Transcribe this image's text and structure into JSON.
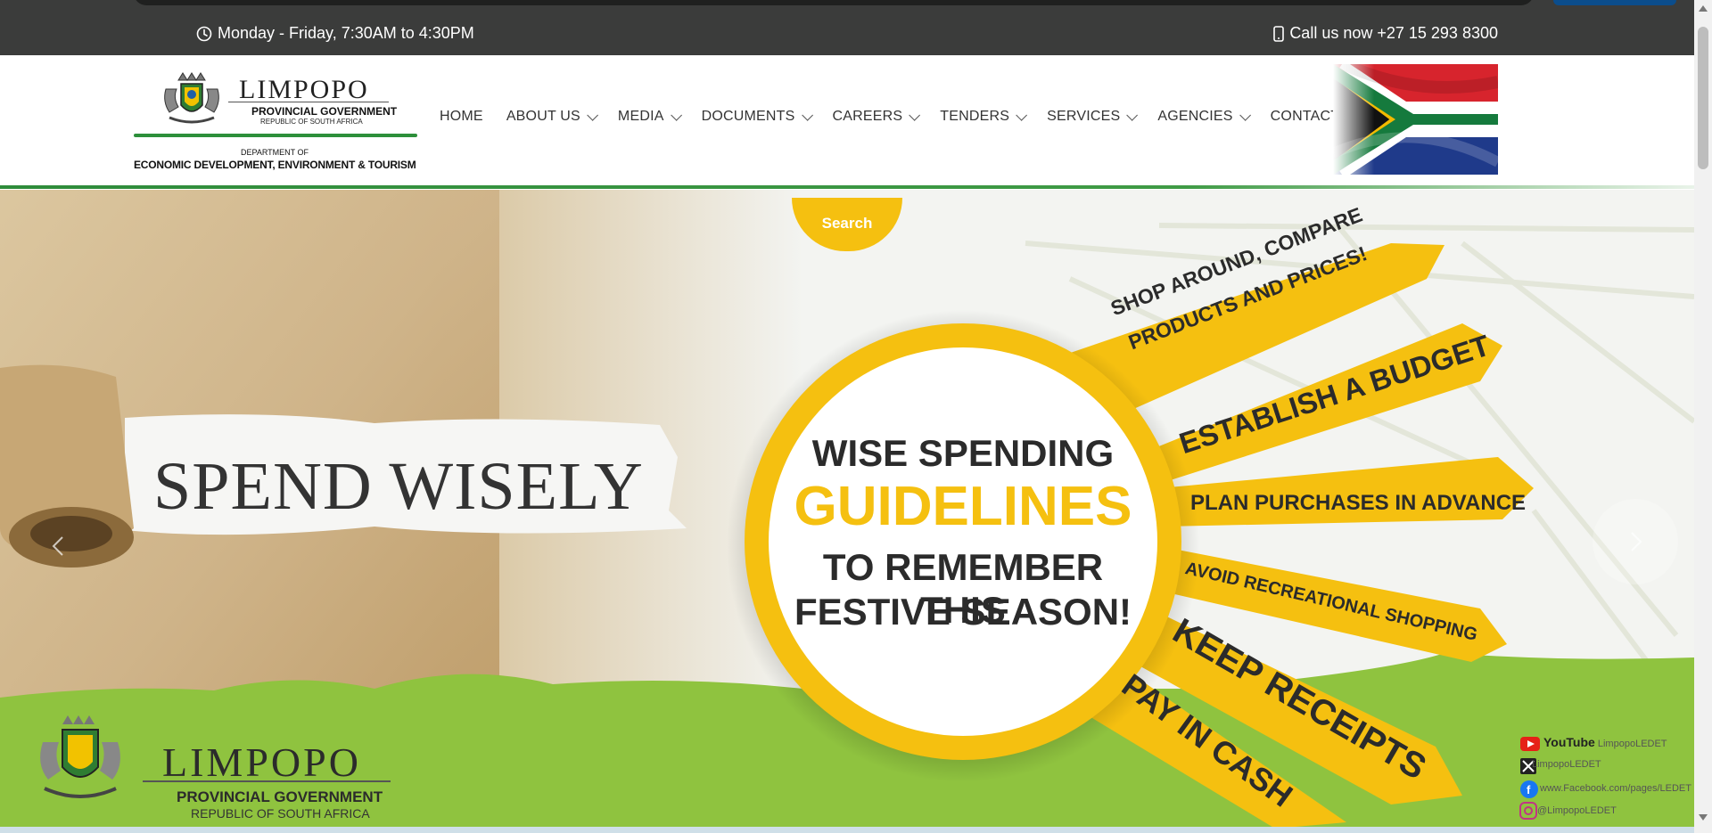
{
  "topbar": {
    "hours": "Monday - Friday, 7:30AM to 4:30PM",
    "phone": "Call us now +27 15 293 8300"
  },
  "logo": {
    "title": "LIMPOPO",
    "subtitle": "PROVINCIAL GOVERNMENT",
    "country": "REPUBLIC OF SOUTH AFRICA",
    "dept_label": "DEPARTMENT OF",
    "dept_name": "ECONOMIC DEVELOPMENT, ENVIRONMENT & TOURISM"
  },
  "nav": {
    "items": [
      {
        "label": "HOME",
        "has_dropdown": false
      },
      {
        "label": "ABOUT US",
        "has_dropdown": true
      },
      {
        "label": "MEDIA",
        "has_dropdown": true
      },
      {
        "label": "DOCUMENTS",
        "has_dropdown": true
      },
      {
        "label": "CAREERS",
        "has_dropdown": true
      },
      {
        "label": "TENDERS",
        "has_dropdown": true
      },
      {
        "label": "SERVICES",
        "has_dropdown": true
      },
      {
        "label": "AGENCIES",
        "has_dropdown": true
      },
      {
        "label": "CONTACTS",
        "has_dropdown": false
      }
    ]
  },
  "search": {
    "label": "Search"
  },
  "slide": {
    "headline": "SPEND WISELY",
    "circle_line1": "WISE SPENDING",
    "circle_line2": "GUIDELINES",
    "circle_line3": "TO REMEMBER THIS",
    "circle_line4": "FESTIVE SEASON!",
    "tips": [
      "SHOP AROUND, COMPARE",
      "PRODUCTS AND PRICES!",
      "ESTABLISH A BUDGET",
      "PLAN PURCHASES IN ADVANCE",
      "AVOID RECREATIONAL SHOPPING",
      "KEEP RECEIPTS",
      "PAY IN CASH"
    ],
    "footer_logo_title": "LIMPOPO",
    "footer_logo_subtitle": "PROVINCIAL GOVERNMENT",
    "footer_logo_country": "REPUBLIC OF SOUTH AFRICA",
    "social": [
      {
        "icon": "youtube-icon",
        "brand": "YouTube",
        "handle": "LimpopoLEDET"
      },
      {
        "icon": "x-icon",
        "brand": "",
        "handle": "LimpopoLEDET"
      },
      {
        "icon": "facebook-icon",
        "brand": "",
        "handle": "www.Facebook.com/pages/LEDET"
      },
      {
        "icon": "instagram-icon",
        "brand": "",
        "handle": "@LimpopoLEDET"
      }
    ]
  },
  "colors": {
    "topbar": "#3b3c3b",
    "accent_yellow": "#f5c010",
    "green": "#8fc33f",
    "brand_green": "#2d8f3a"
  }
}
